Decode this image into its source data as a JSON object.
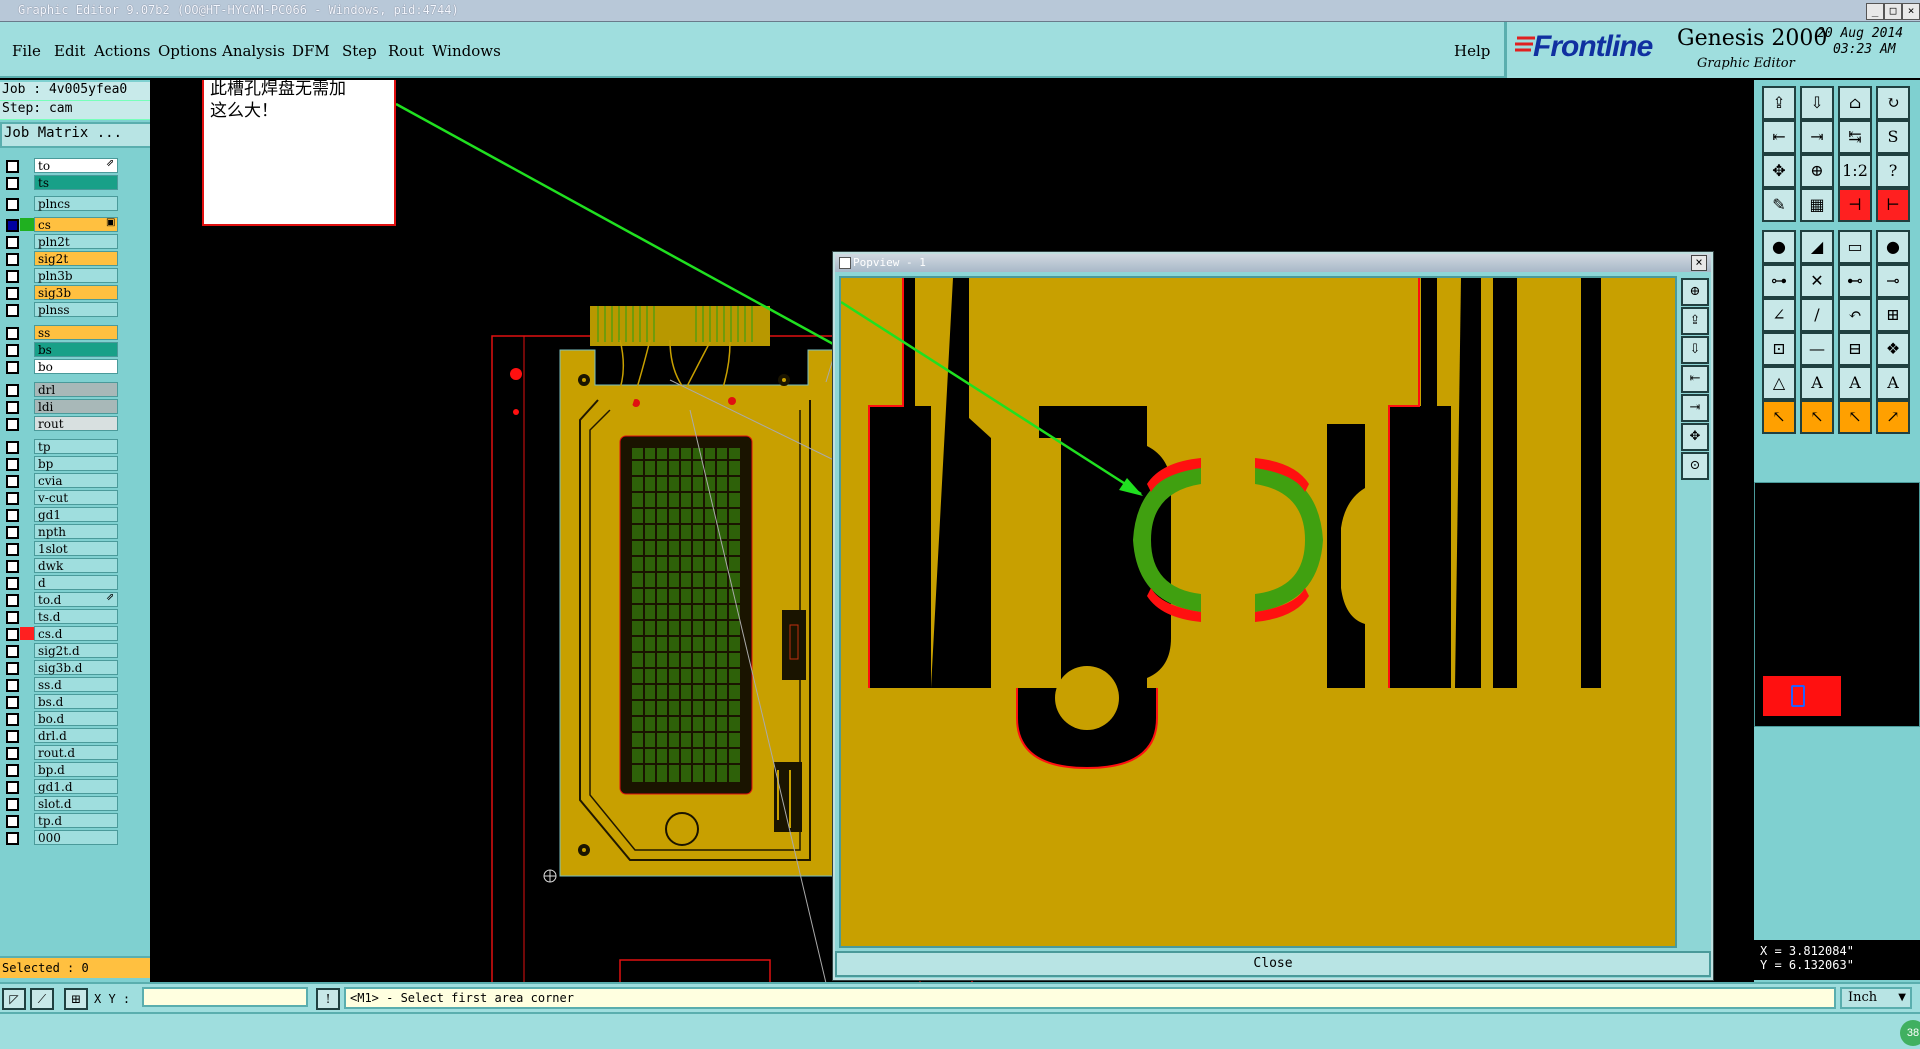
{
  "window": {
    "title": "Graphic Editor 9.07b2 (OO@HT-HYCAM-PC066 - Windows, pid:4744)",
    "min": "_",
    "max": "□",
    "close": "×"
  },
  "menu": {
    "items": [
      "File",
      "Edit",
      "Actions",
      "Options",
      "Analysis",
      "DFM",
      "Step",
      "Rout",
      "Windows"
    ],
    "help": "Help"
  },
  "brand": {
    "logo": "Frontline",
    "product": "Genesis 2000",
    "subtitle": "Graphic Editor",
    "date": "20 Aug 2014",
    "time": "03:23 AM"
  },
  "job": {
    "job_line": "Job : 4v005yfea0",
    "step_line": "Step: cam",
    "matrix_button": "Job Matrix ..."
  },
  "layers": [
    {
      "name": "to",
      "color": "#ffffff",
      "sw": "",
      "mark": "⇗"
    },
    {
      "name": "ts",
      "color": "#18a088",
      "sw": ""
    },
    {
      "name": "plncs",
      "color": "#9fdede",
      "sw": ""
    },
    {
      "name": "cs",
      "color": "#ffc040",
      "sw": "#20b020",
      "sel": true,
      "mark": "▣"
    },
    {
      "name": "pln2t",
      "color": "#9fdede",
      "sw": ""
    },
    {
      "name": "sig2t",
      "color": "#ffc040",
      "sw": ""
    },
    {
      "name": "pln3b",
      "color": "#9fdede",
      "sw": ""
    },
    {
      "name": "sig3b",
      "color": "#ffc040",
      "sw": ""
    },
    {
      "name": "plnss",
      "color": "#9fdede",
      "sw": ""
    },
    {
      "name": "ss",
      "color": "#ffc040",
      "sw": ""
    },
    {
      "name": "bs",
      "color": "#18a088",
      "sw": ""
    },
    {
      "name": "bo",
      "color": "#ffffff",
      "sw": ""
    },
    {
      "name": "drl",
      "color": "#a8b8b8",
      "sw": ""
    },
    {
      "name": "ldi",
      "color": "#a8b8b8",
      "sw": ""
    },
    {
      "name": "rout",
      "color": "#d8e0e0",
      "sw": ""
    },
    {
      "name": "tp",
      "color": "#9fdede",
      "sw": ""
    },
    {
      "name": "bp",
      "color": "#9fdede",
      "sw": ""
    },
    {
      "name": "cvia",
      "color": "#9fdede",
      "sw": ""
    },
    {
      "name": "v-cut",
      "color": "#9fdede",
      "sw": ""
    },
    {
      "name": "gd1",
      "color": "#9fdede",
      "sw": ""
    },
    {
      "name": "npth",
      "color": "#9fdede",
      "sw": ""
    },
    {
      "name": "1slot",
      "color": "#9fdede",
      "sw": ""
    },
    {
      "name": "dwk",
      "color": "#9fdede",
      "sw": ""
    },
    {
      "name": "d",
      "color": "#9fdede",
      "sw": ""
    },
    {
      "name": "to.d",
      "color": "#9fdede",
      "sw": "",
      "mark": "⇗"
    },
    {
      "name": "ts.d",
      "color": "#9fdede",
      "sw": ""
    },
    {
      "name": "cs.d",
      "color": "#9fdede",
      "sw": "#ff2020"
    },
    {
      "name": "sig2t.d",
      "color": "#9fdede",
      "sw": ""
    },
    {
      "name": "sig3b.d",
      "color": "#9fdede",
      "sw": ""
    },
    {
      "name": "ss.d",
      "color": "#9fdede",
      "sw": ""
    },
    {
      "name": "bs.d",
      "color": "#9fdede",
      "sw": ""
    },
    {
      "name": "bo.d",
      "color": "#9fdede",
      "sw": ""
    },
    {
      "name": "drl.d",
      "color": "#9fdede",
      "sw": ""
    },
    {
      "name": "rout.d",
      "color": "#9fdede",
      "sw": ""
    },
    {
      "name": "bp.d",
      "color": "#9fdede",
      "sw": ""
    },
    {
      "name": "gd1.d",
      "color": "#9fdede",
      "sw": ""
    },
    {
      "name": "slot.d",
      "color": "#9fdede",
      "sw": ""
    },
    {
      "name": "tp.d",
      "color": "#9fdede",
      "sw": ""
    },
    {
      "name": "000",
      "color": "#9fdede",
      "sw": ""
    }
  ],
  "selected": "Selected : 0",
  "annotation": {
    "line1": "此槽孔焊盘无需加",
    "line2": "这么大！"
  },
  "popview": {
    "title": "Popview - 1",
    "close_label": "Close",
    "close_x": "×"
  },
  "status": {
    "xy_label": "X Y :",
    "xy_value": "",
    "prompt": "<M1> - Select first area corner",
    "units": "Inch",
    "badge": "38"
  },
  "coords": {
    "x": "X = 3.812084\"",
    "y": "Y = 6.132063\""
  },
  "colors": {
    "copper": "#b89800",
    "board": "#c8a000",
    "pad": "#40a010",
    "outline": "#ff1010",
    "annotation_arrow": "#20e020"
  }
}
